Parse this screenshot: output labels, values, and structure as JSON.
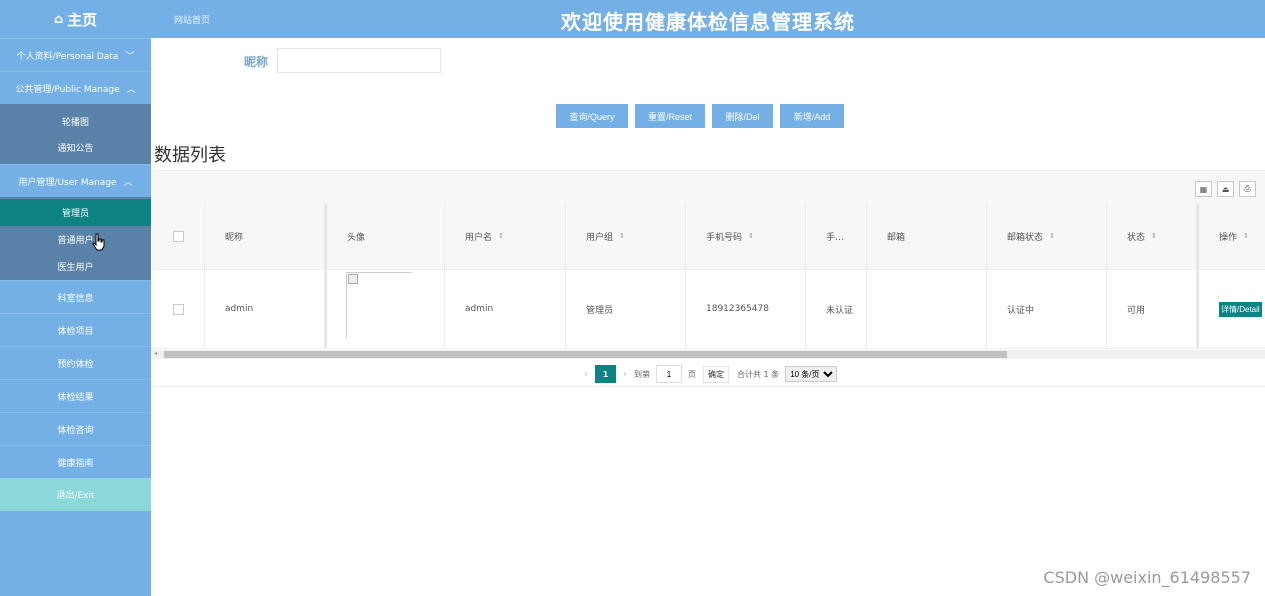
{
  "sidebar": {
    "home_label": "主页",
    "groups": [
      {
        "label": "个人资料/Personal Data",
        "chevron": "chevron-down-icon"
      },
      {
        "label": "公共管理/Public Manage",
        "chevron": "chevron-up-icon",
        "items": [
          "轮播图",
          "通知公告"
        ]
      },
      {
        "label": "用户管理/User Manage",
        "chevron": "chevron-up-icon",
        "items": [
          "管理员",
          "普通用户",
          "医生用户"
        ]
      }
    ],
    "links": [
      "科室信息",
      "体检项目",
      "预约体检",
      "体检结果",
      "体检咨询",
      "健康指南"
    ],
    "exit_label": "退出/Exit"
  },
  "header": {
    "breadcrumb": "网站首页",
    "title": "欢迎使用健康体检信息管理系统"
  },
  "search": {
    "label": "昵称",
    "value": "",
    "placeholder": ""
  },
  "buttons": {
    "query": "查询/Query",
    "reset": "重置/Reset",
    "delete": "删除/Del",
    "add": "新增/Add"
  },
  "list_title": "数据列表",
  "table": {
    "headers": [
      "昵称",
      "头像",
      "用户名",
      "用户组",
      "手机号码",
      "手…",
      "邮箱",
      "邮箱状态",
      "状态",
      "操作"
    ],
    "rows": [
      {
        "nickname": "admin",
        "username": "admin",
        "group": "管理员",
        "phone": "18912365478",
        "phone_status": "未认证",
        "email": "",
        "email_status": "认证中",
        "status": "可用",
        "action": "详情/Detail"
      }
    ]
  },
  "pagination": {
    "current_page": "1",
    "goto_label": "到第",
    "goto_value": "1",
    "page_unit": "页",
    "confirm": "确定",
    "total": "合计共 1 条",
    "page_size": "10 条/页"
  },
  "watermark": "CSDN @weixin_61498557",
  "colors": {
    "sidebar": "#74b0e6",
    "submenu": "#5a82a8",
    "active": "#0d8383",
    "exit": "#8ad8da"
  }
}
